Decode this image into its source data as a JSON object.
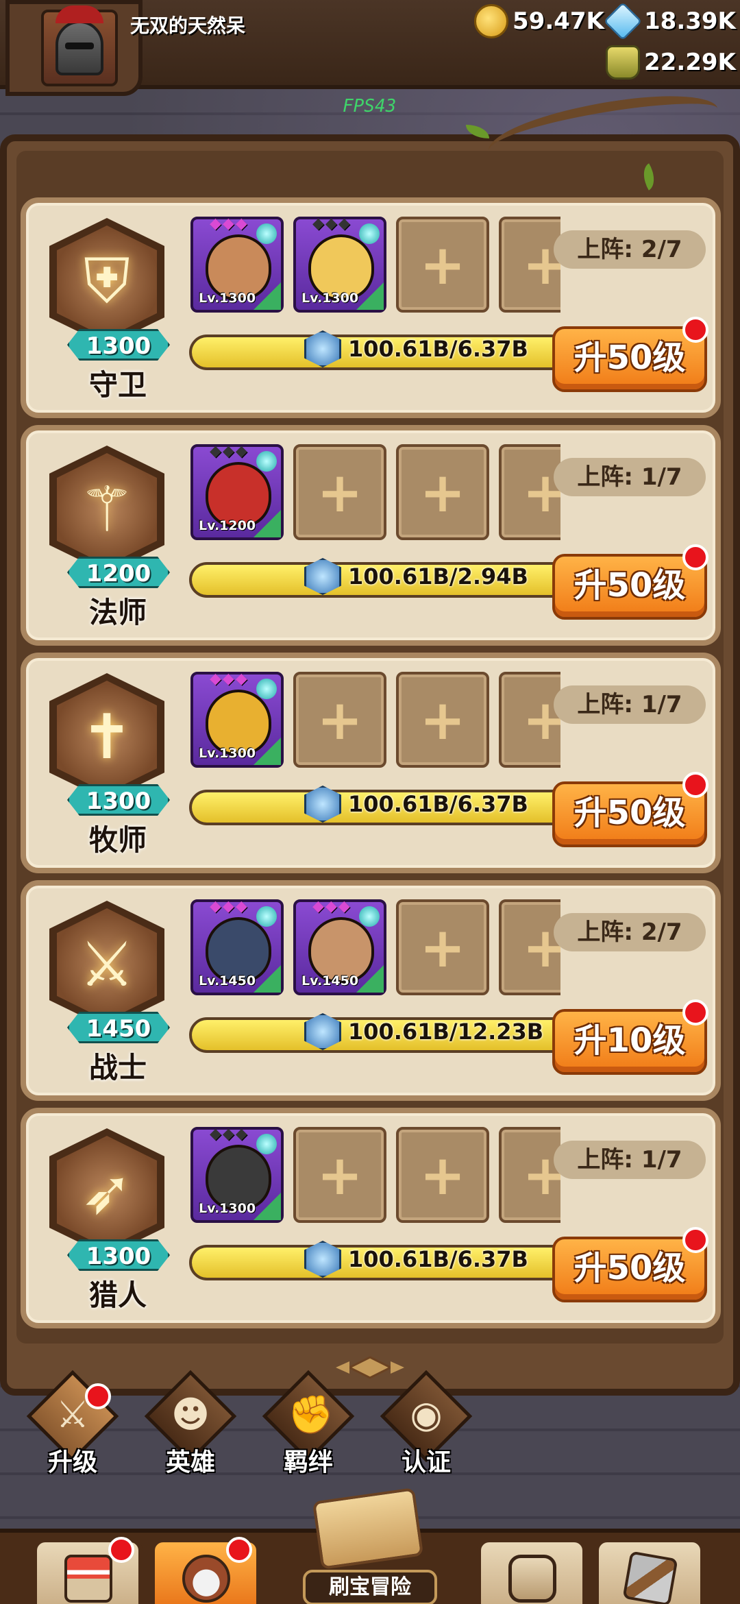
{
  "header": {
    "player_name": "无双的天然呆",
    "gold": "59.47K",
    "gems": "18.39K",
    "potions": "22.29K",
    "fps": "FPS43"
  },
  "classes": [
    {
      "name": "守卫",
      "level": "1300",
      "icon": "shield-icon",
      "deploy": "上阵: 2/7",
      "progress_text": "100.61B/6.37B",
      "progress": 0.98,
      "button": "升50级",
      "heroes": [
        {
          "level": "Lv.1300",
          "stars": "◆◆◆",
          "star_color": "#d94ad4",
          "face": "#c98a5a"
        },
        {
          "level": "Lv.1300",
          "stars": "◆◆◆",
          "star_color": "#333333",
          "face": "#f0c85a"
        }
      ]
    },
    {
      "name": "法师",
      "level": "1200",
      "icon": "staff-icon",
      "deploy": "上阵: 1/7",
      "progress_text": "100.61B/2.94B",
      "progress": 0.98,
      "button": "升50级",
      "heroes": [
        {
          "level": "Lv.1200",
          "stars": "◆◆◆",
          "star_color": "#333333",
          "face": "#c8302a"
        }
      ]
    },
    {
      "name": "牧师",
      "level": "1300",
      "icon": "holy-cross-icon",
      "deploy": "上阵: 1/7",
      "progress_text": "100.61B/6.37B",
      "progress": 0.98,
      "button": "升50级",
      "heroes": [
        {
          "level": "Lv.1300",
          "stars": "◆◆◆",
          "star_color": "#d94ad4",
          "face": "#e8b030"
        }
      ]
    },
    {
      "name": "战士",
      "level": "1450",
      "icon": "sword-icon",
      "deploy": "上阵: 2/7",
      "progress_text": "100.61B/12.23B",
      "progress": 0.98,
      "button": "升10级",
      "heroes": [
        {
          "level": "Lv.1450",
          "stars": "◆◆◆",
          "star_color": "#d94ad4",
          "face": "#3a4a6a"
        },
        {
          "level": "Lv.1450",
          "stars": "◆◆◆",
          "star_color": "#d94ad4",
          "face": "#c8946a"
        }
      ]
    },
    {
      "name": "猎人",
      "level": "1300",
      "icon": "bow-icon",
      "deploy": "上阵: 1/7",
      "progress_text": "100.61B/6.37B",
      "progress": 0.98,
      "button": "升50级",
      "heroes": [
        {
          "level": "Lv.1300",
          "stars": "◆◆◆",
          "star_color": "#333333",
          "face": "#3a3a3a"
        }
      ]
    }
  ],
  "subtabs": [
    {
      "label": "升级",
      "icon": "upgrade-sword-icon",
      "badge": true
    },
    {
      "label": "英雄",
      "icon": "hero-icon",
      "badge": false
    },
    {
      "label": "羁绊",
      "icon": "handshake-icon",
      "badge": false
    },
    {
      "label": "认证",
      "icon": "eye-icon",
      "badge": false
    }
  ],
  "bottom_nav": {
    "adventure_label": "刷宝冒险"
  }
}
